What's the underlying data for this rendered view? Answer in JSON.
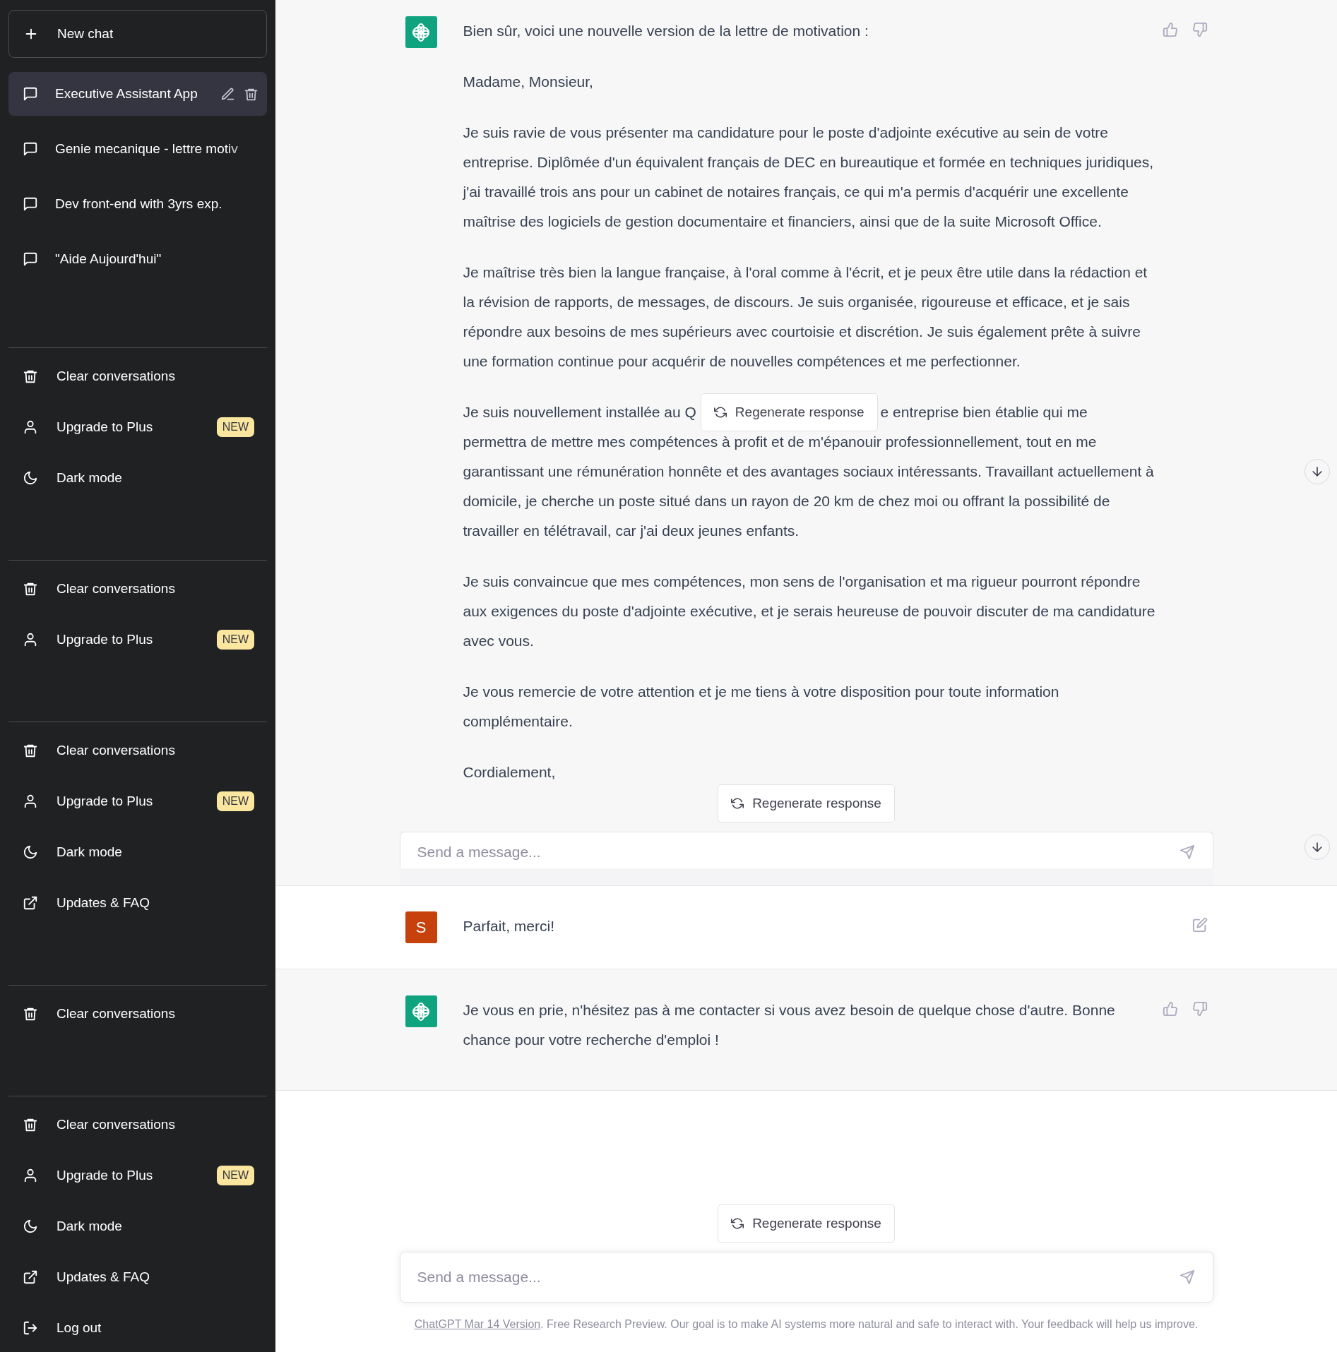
{
  "sidebar": {
    "new_chat": {
      "label": "New chat"
    },
    "conversations": [
      {
        "title": "Executive Assistant App",
        "selected": true
      },
      {
        "title": "Genie mecanique - lettre motiv",
        "selected": false,
        "faded": true
      },
      {
        "title": "Dev front-end with 3yrs exp.",
        "selected": false
      },
      {
        "title": "\"Aide Aujourd'hui\"",
        "selected": false
      }
    ],
    "menu_groups": [
      {
        "items": [
          {
            "kind": "clear",
            "label": "Clear conversations"
          },
          {
            "kind": "upgrade",
            "label": "Upgrade to Plus",
            "badge": "NEW"
          },
          {
            "kind": "dark",
            "label": "Dark mode"
          }
        ]
      },
      {
        "items": [
          {
            "kind": "clear",
            "label": "Clear conversations"
          },
          {
            "kind": "upgrade",
            "label": "Upgrade to Plus",
            "badge": "NEW"
          }
        ]
      },
      {
        "items": [
          {
            "kind": "clear",
            "label": "Clear conversations"
          },
          {
            "kind": "upgrade",
            "label": "Upgrade to Plus",
            "badge": "NEW"
          },
          {
            "kind": "dark",
            "label": "Dark mode"
          },
          {
            "kind": "updates",
            "label": "Updates & FAQ"
          }
        ]
      },
      {
        "items": [
          {
            "kind": "clear",
            "label": "Clear conversations"
          }
        ]
      },
      {
        "items": [
          {
            "kind": "clear",
            "label": "Clear conversations"
          },
          {
            "kind": "upgrade",
            "label": "Upgrade to Plus",
            "badge": "NEW"
          },
          {
            "kind": "dark",
            "label": "Dark mode"
          },
          {
            "kind": "updates",
            "label": "Updates & FAQ"
          },
          {
            "kind": "logout",
            "label": "Log out"
          }
        ]
      }
    ]
  },
  "messages": [
    {
      "kind": "assistant",
      "paragraphs": [
        {
          "kind": "text",
          "text": "Bien sûr, voici une nouvelle version de la lettre de motivation :"
        },
        {
          "kind": "text",
          "text": "Madame, Monsieur,"
        },
        {
          "kind": "text",
          "text": "Je suis ravie de vous présenter ma candidature pour le poste d'adjointe exécutive au sein de votre entreprise. Diplômée d'un équivalent français de DEC en bureautique et formée en techniques juridiques, j'ai travaillé trois ans pour un cabinet de notaires français, ce qui m'a permis d'acquérir une excellente maîtrise des logiciels de gestion documentaire et financiers, ainsi que de la suite Microsoft Office."
        },
        {
          "kind": "text",
          "text": "Je maîtrise très bien la langue française, à l'oral comme à l'écrit, et je peux être utile dans la rédaction et la révision de rapports, de messages, de discours. Je suis organisée, rigoureuse et efficace, et je sais répondre aux besoins de mes supérieurs avec courtoisie et discrétion. Je suis également prête à suivre une formation continue pour acquérir de nouvelles compétences et me perfectionner."
        },
        {
          "kind": "covered",
          "before": "Je suis nouvellement installée au Q",
          "button": "Regenerate response",
          "after": "e entreprise bien établie qui me",
          "rest": "permettra de mettre mes compétences à profit et de m'épanouir professionnellement, tout en me garantissant une rémunération honnête et des avantages sociaux intéressants. Travaillant actuellement à domicile, je cherche un poste situé dans un rayon de 20 km de chez moi ou offrant la possibilité de travailler en télétravail, car j'ai deux jeunes enfants."
        },
        {
          "kind": "text",
          "text": "Je suis convaincue que mes compétences, mon sens de l'organisation et ma rigueur pourront répondre aux exigences du poste d'adjointe exécutive, et je serais heureuse de pouvoir discuter de ma candidature avec vous."
        },
        {
          "kind": "text",
          "text": "Je vous remercie de votre attention et je me tiens à votre disposition pour toute information complémentaire."
        },
        {
          "kind": "text",
          "text": "Cordialement,"
        }
      ],
      "overlay_composer": {
        "regenerate": "Regenerate response",
        "placeholder": "Send a message..."
      }
    },
    {
      "kind": "user",
      "avatar": "S",
      "paragraphs": [
        {
          "kind": "text",
          "text": "Parfait, merci!"
        }
      ]
    },
    {
      "kind": "assistant",
      "paragraphs": [
        {
          "kind": "text",
          "text": "Je vous en prie, n'hésitez pas à me contacter si vous avez besoin de quelque chose d'autre. Bonne chance pour votre recherche d'emploi !"
        }
      ]
    }
  ],
  "composer": {
    "regenerate": "Regenerate response",
    "placeholder": "Send a message..."
  },
  "footer": {
    "link": "ChatGPT Mar 14 Version",
    "text": ". Free Research Preview. Our goal is to make AI systems more natural and safe to interact with. Your feedback will help us improve."
  }
}
